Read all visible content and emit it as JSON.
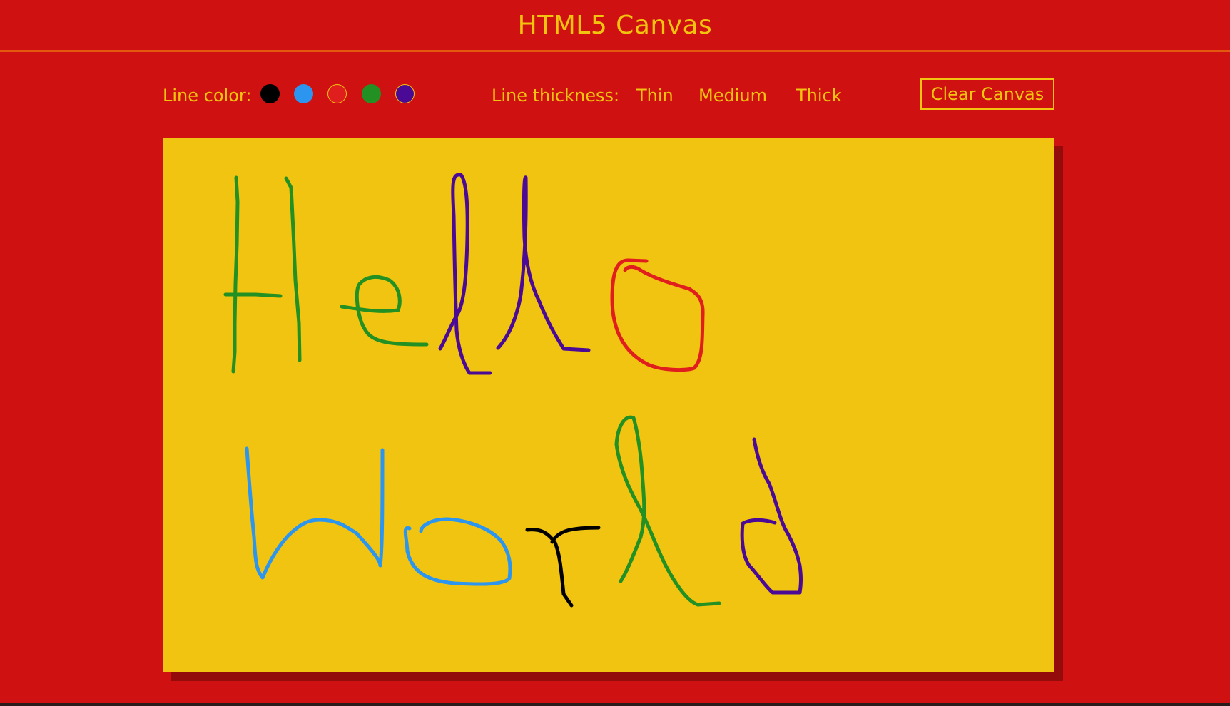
{
  "header": {
    "title": "HTML5 Canvas"
  },
  "toolbar": {
    "line_color_label": "Line color:",
    "colors": [
      {
        "name": "black",
        "hex": "#000000",
        "selected": false
      },
      {
        "name": "blue",
        "hex": "#2b95f0",
        "selected": false
      },
      {
        "name": "red",
        "hex": "#e01e1e",
        "selected": true
      },
      {
        "name": "green",
        "hex": "#229022",
        "selected": false
      },
      {
        "name": "purple",
        "hex": "#4b0a96",
        "selected": false
      }
    ],
    "line_thickness_label": "Line thickness:",
    "thickness_options": [
      "Thin",
      "Medium",
      "Thick"
    ],
    "clear_label": "Clear Canvas"
  },
  "theme": {
    "page_bg": "#cf1111",
    "accent": "#f2c40f",
    "canvas_bg": "#f0c410",
    "header_rule": "#e3590f"
  },
  "drawing": {
    "strokes": [
      {
        "color": "#229022",
        "label": "H-left"
      },
      {
        "color": "#229022",
        "label": "H-bar"
      },
      {
        "color": "#229022",
        "label": "H-right"
      },
      {
        "color": "#229022",
        "label": "e"
      },
      {
        "color": "#4b0a96",
        "label": "l-1"
      },
      {
        "color": "#4b0a96",
        "label": "l-2"
      },
      {
        "color": "#e01e1e",
        "label": "o"
      },
      {
        "color": "#2b95f0",
        "label": "W"
      },
      {
        "color": "#2b95f0",
        "label": "o"
      },
      {
        "color": "#000000",
        "label": "r"
      },
      {
        "color": "#229022",
        "label": "l"
      },
      {
        "color": "#4b0a96",
        "label": "d"
      }
    ]
  }
}
